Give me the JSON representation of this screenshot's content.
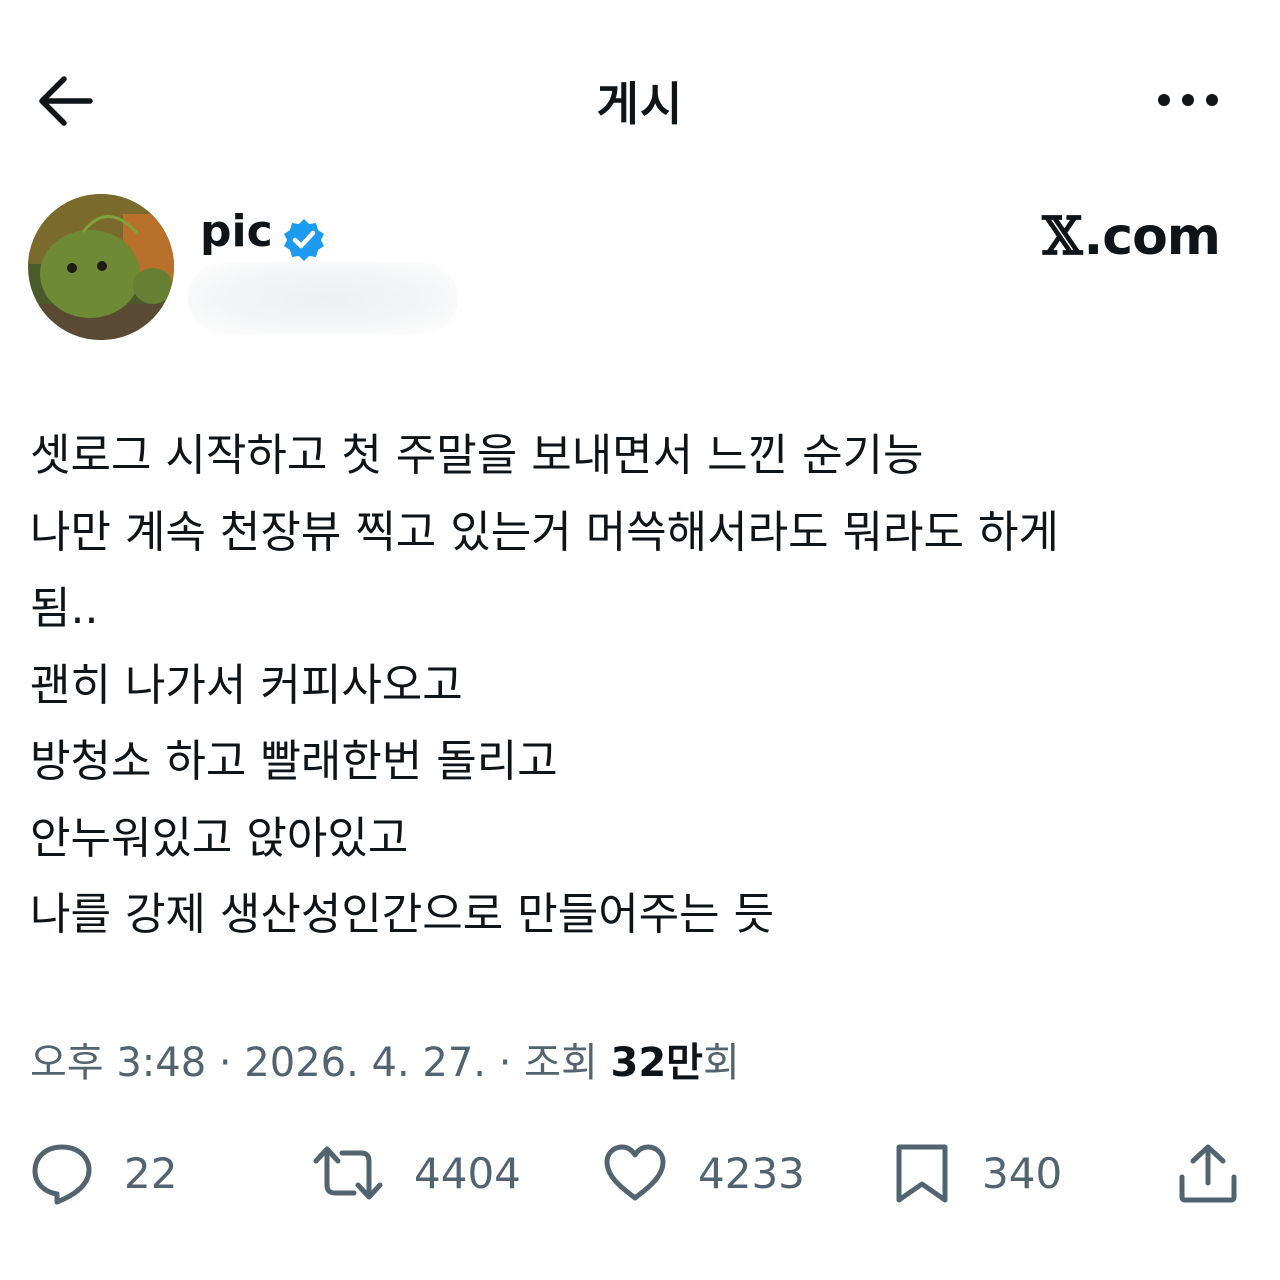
{
  "header": {
    "title": "게시",
    "back_icon": "arrow-left-icon",
    "more_icon": "more-horizontal-icon"
  },
  "author": {
    "name": "pic",
    "verified_icon": "verified-badge-icon",
    "verified_color": "#1d9bf0",
    "source": ".com",
    "source_logo": "𝕏"
  },
  "post": {
    "text": "셋로그 시작하고 첫 주말을 보내면서 느낀 순기능\n나만 계속 천장뷰 찍고 있는거 머쓱해서라도 뭐라도 하게\n됨..\n괜히 나가서 커피사오고\n방청소 하고 빨래한번 돌리고\n안누워있고 앉아있고\n나를 강제 생산성인간으로 만들어주는 듯"
  },
  "meta": {
    "time": "오후 3:48",
    "sep1": " · ",
    "date": "2026. 4. 27.",
    "sep2": " · ",
    "views_prefix": "조회 ",
    "views_count": "32만",
    "views_suffix": "회"
  },
  "actions": {
    "reply": {
      "icon": "reply-bubble-icon",
      "count": "22"
    },
    "repost": {
      "icon": "repost-icon",
      "count": "4404"
    },
    "like": {
      "icon": "heart-icon",
      "count": "4233"
    },
    "bookmark": {
      "icon": "bookmark-icon",
      "count": "340"
    },
    "share": {
      "icon": "share-upload-icon"
    }
  },
  "colors": {
    "text": "#0f1419",
    "muted": "#536471",
    "accent": "#1d9bf0"
  }
}
